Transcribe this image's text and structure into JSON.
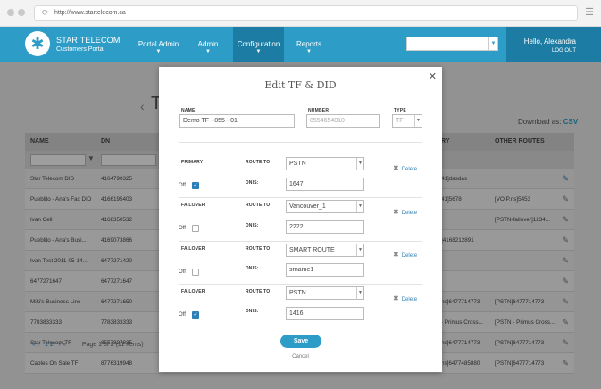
{
  "browser": {
    "url": "http://www.startelecom.ca"
  },
  "brand": {
    "line1": "STAR TELECOM",
    "line2": "Customers Portal"
  },
  "nav": {
    "items": [
      {
        "label": "Portal Admin"
      },
      {
        "label": "Admin"
      },
      {
        "label": "Configuration"
      },
      {
        "label": "Reports"
      }
    ],
    "user": {
      "greeting": "Hello, Alexandra",
      "logout": "LOG OUT"
    }
  },
  "page": {
    "title_initial": "T",
    "download_label": "Download as:",
    "download_format": "CSV"
  },
  "table": {
    "headers": {
      "name": "NAME",
      "dn": "DN",
      "ry": "RY",
      "other": "OTHER ROUTES"
    },
    "rows": [
      {
        "name": "Star Telecom DID",
        "dn": "4164790325",
        "ry": "41]dasdas",
        "other": ""
      },
      {
        "name": "Pueblito - Ana's Fax DID",
        "dn": "4166195403",
        "ry": "41]5678",
        "other": "[VOIP.ns]5453"
      },
      {
        "name": "Ivan Cell",
        "dn": "4168350532",
        "ry": "",
        "other": "[PSTN-failover]1234..."
      },
      {
        "name": "Pueblito - Ana's Busi...",
        "dn": "4169073866",
        "ry": "]4168212891",
        "other": ""
      },
      {
        "name": "Ivan Test 2011-05-14...",
        "dn": "6477271420",
        "ry": "",
        "other": ""
      },
      {
        "name": "6477271647",
        "dn": "6477271647",
        "ry": "",
        "other": ""
      },
      {
        "name": "Miki's Business Line",
        "dn": "6477271650",
        "ry": "ns]6477714773",
        "other": "[PSTN]6477714773"
      },
      {
        "name": "7783833333",
        "dn": "7783833333",
        "ry": "- Primus Cross...",
        "other": "[PSTN - Primus Cross..."
      },
      {
        "name": "Star Telecom TF",
        "dn": "8557827835",
        "ry": "ns]6477714773",
        "other": "[PSTN]6477714773"
      },
      {
        "name": "Cables On Sale TF",
        "dn": "8776319948",
        "ry": "ns]6477485880",
        "other": "[PSTN]6477714773"
      }
    ]
  },
  "pager": {
    "prev_first": "«",
    "prev": "‹",
    "page1": "1",
    "page2": "2",
    "next": "›",
    "next_last": "»",
    "info": "Page 1 of 2 (11 Items)"
  },
  "modal": {
    "title": "Edit TF & DID",
    "name_label": "NAME",
    "name_value": "Demo TF - 855 - 01",
    "number_label": "NUMBER",
    "number_value": "8554654010",
    "type_label": "TYPE",
    "type_value": "TF",
    "route_to_label": "ROUTE TO",
    "dnis_label": "DNIS:",
    "off_label": "Off",
    "delete_label": "Delete",
    "routes": [
      {
        "kind": "PRIMARY",
        "route": "PSTN",
        "dnis": "1647",
        "checked": true
      },
      {
        "kind": "FAILOVER",
        "route": "Vancouver_1",
        "dnis": "2222",
        "checked": false
      },
      {
        "kind": "FAILOVER",
        "route": "SMART ROUTE",
        "dnis": "srname1",
        "checked": false
      },
      {
        "kind": "FAILOVER",
        "route": "PSTN",
        "dnis": "1416",
        "checked": true
      }
    ],
    "save_label": "Save",
    "cancel_label": "Cancel"
  }
}
